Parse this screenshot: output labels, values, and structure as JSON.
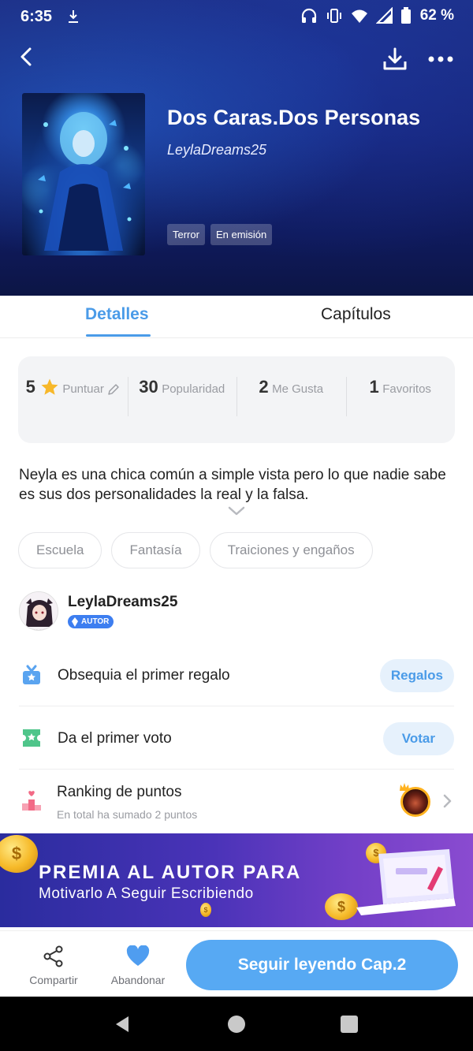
{
  "status_bar": {
    "time": "6:35",
    "battery_percent": "62 %"
  },
  "book": {
    "title": "Dos Caras.Dos Personas",
    "author": "LeylaDreams25",
    "genre_tags": [
      "Terror",
      "En emisión"
    ]
  },
  "tabs": {
    "details": "Detalles",
    "chapters": "Capítulos",
    "active": "Detalles"
  },
  "stats": {
    "rating": {
      "value": "5",
      "label": "Puntuar"
    },
    "popularity": {
      "value": "30",
      "label": "Popularidad"
    },
    "likes": {
      "value": "2",
      "label": "Me Gusta"
    },
    "favorites": {
      "value": "1",
      "label": "Favoritos"
    }
  },
  "synopsis": "Neyla es una chica común a simple vista pero lo que nadie sabe es sus dos personalidades la real y la falsa.",
  "topic_tags": [
    "Escuela",
    "Fantasía",
    "Traiciones y engaños"
  ],
  "author_section": {
    "name": "LeylaDreams25",
    "badge": "AUTOR"
  },
  "actions": {
    "gift": {
      "label": "Obsequia el primer regalo",
      "button": "Regalos"
    },
    "vote": {
      "label": "Da el primer voto",
      "button": "Votar"
    },
    "ranking": {
      "label": "Ranking de puntos",
      "subtitle": "En total ha sumado 2 puntos"
    }
  },
  "banner": {
    "line1": "PREMIA AL AUTOR PARA",
    "line2": "Motivarlo A Seguir Escribiendo"
  },
  "bottom_bar": {
    "share": "Compartir",
    "abandon": "Abandonar",
    "continue_reading": "Seguir leyendo Cap.2"
  },
  "colors": {
    "accent": "#4a9be8",
    "primary_button": "#57a9f3",
    "hero_background": "#17257a",
    "banner_background": "#4a33b8"
  },
  "icons": [
    "back-arrow-icon",
    "download-icon",
    "more-icon",
    "star-icon",
    "edit-pencil-icon",
    "chevron-down-icon",
    "gift-icon",
    "vote-ticket-icon",
    "podium-icon",
    "chevron-right-icon",
    "share-icon",
    "heart-icon"
  ]
}
